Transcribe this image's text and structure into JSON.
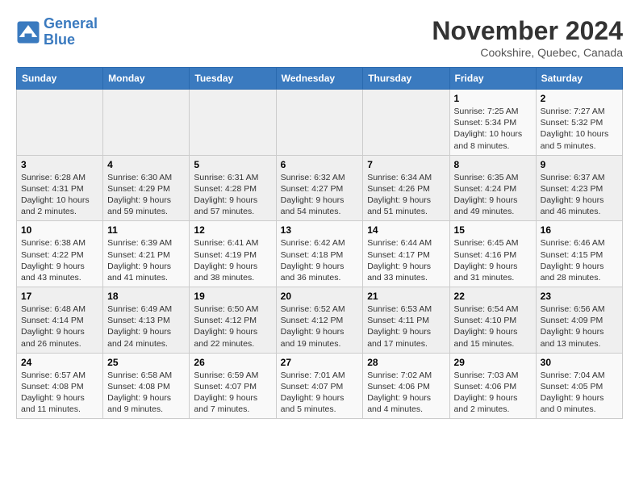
{
  "logo": {
    "line1": "General",
    "line2": "Blue"
  },
  "title": "November 2024",
  "location": "Cookshire, Quebec, Canada",
  "weekdays": [
    "Sunday",
    "Monday",
    "Tuesday",
    "Wednesday",
    "Thursday",
    "Friday",
    "Saturday"
  ],
  "rows": [
    [
      {
        "day": "",
        "info": ""
      },
      {
        "day": "",
        "info": ""
      },
      {
        "day": "",
        "info": ""
      },
      {
        "day": "",
        "info": ""
      },
      {
        "day": "",
        "info": ""
      },
      {
        "day": "1",
        "info": "Sunrise: 7:25 AM\nSunset: 5:34 PM\nDaylight: 10 hours and 8 minutes."
      },
      {
        "day": "2",
        "info": "Sunrise: 7:27 AM\nSunset: 5:32 PM\nDaylight: 10 hours and 5 minutes."
      }
    ],
    [
      {
        "day": "3",
        "info": "Sunrise: 6:28 AM\nSunset: 4:31 PM\nDaylight: 10 hours and 2 minutes."
      },
      {
        "day": "4",
        "info": "Sunrise: 6:30 AM\nSunset: 4:29 PM\nDaylight: 9 hours and 59 minutes."
      },
      {
        "day": "5",
        "info": "Sunrise: 6:31 AM\nSunset: 4:28 PM\nDaylight: 9 hours and 57 minutes."
      },
      {
        "day": "6",
        "info": "Sunrise: 6:32 AM\nSunset: 4:27 PM\nDaylight: 9 hours and 54 minutes."
      },
      {
        "day": "7",
        "info": "Sunrise: 6:34 AM\nSunset: 4:26 PM\nDaylight: 9 hours and 51 minutes."
      },
      {
        "day": "8",
        "info": "Sunrise: 6:35 AM\nSunset: 4:24 PM\nDaylight: 9 hours and 49 minutes."
      },
      {
        "day": "9",
        "info": "Sunrise: 6:37 AM\nSunset: 4:23 PM\nDaylight: 9 hours and 46 minutes."
      }
    ],
    [
      {
        "day": "10",
        "info": "Sunrise: 6:38 AM\nSunset: 4:22 PM\nDaylight: 9 hours and 43 minutes."
      },
      {
        "day": "11",
        "info": "Sunrise: 6:39 AM\nSunset: 4:21 PM\nDaylight: 9 hours and 41 minutes."
      },
      {
        "day": "12",
        "info": "Sunrise: 6:41 AM\nSunset: 4:19 PM\nDaylight: 9 hours and 38 minutes."
      },
      {
        "day": "13",
        "info": "Sunrise: 6:42 AM\nSunset: 4:18 PM\nDaylight: 9 hours and 36 minutes."
      },
      {
        "day": "14",
        "info": "Sunrise: 6:44 AM\nSunset: 4:17 PM\nDaylight: 9 hours and 33 minutes."
      },
      {
        "day": "15",
        "info": "Sunrise: 6:45 AM\nSunset: 4:16 PM\nDaylight: 9 hours and 31 minutes."
      },
      {
        "day": "16",
        "info": "Sunrise: 6:46 AM\nSunset: 4:15 PM\nDaylight: 9 hours and 28 minutes."
      }
    ],
    [
      {
        "day": "17",
        "info": "Sunrise: 6:48 AM\nSunset: 4:14 PM\nDaylight: 9 hours and 26 minutes."
      },
      {
        "day": "18",
        "info": "Sunrise: 6:49 AM\nSunset: 4:13 PM\nDaylight: 9 hours and 24 minutes."
      },
      {
        "day": "19",
        "info": "Sunrise: 6:50 AM\nSunset: 4:12 PM\nDaylight: 9 hours and 22 minutes."
      },
      {
        "day": "20",
        "info": "Sunrise: 6:52 AM\nSunset: 4:12 PM\nDaylight: 9 hours and 19 minutes."
      },
      {
        "day": "21",
        "info": "Sunrise: 6:53 AM\nSunset: 4:11 PM\nDaylight: 9 hours and 17 minutes."
      },
      {
        "day": "22",
        "info": "Sunrise: 6:54 AM\nSunset: 4:10 PM\nDaylight: 9 hours and 15 minutes."
      },
      {
        "day": "23",
        "info": "Sunrise: 6:56 AM\nSunset: 4:09 PM\nDaylight: 9 hours and 13 minutes."
      }
    ],
    [
      {
        "day": "24",
        "info": "Sunrise: 6:57 AM\nSunset: 4:08 PM\nDaylight: 9 hours and 11 minutes."
      },
      {
        "day": "25",
        "info": "Sunrise: 6:58 AM\nSunset: 4:08 PM\nDaylight: 9 hours and 9 minutes."
      },
      {
        "day": "26",
        "info": "Sunrise: 6:59 AM\nSunset: 4:07 PM\nDaylight: 9 hours and 7 minutes."
      },
      {
        "day": "27",
        "info": "Sunrise: 7:01 AM\nSunset: 4:07 PM\nDaylight: 9 hours and 5 minutes."
      },
      {
        "day": "28",
        "info": "Sunrise: 7:02 AM\nSunset: 4:06 PM\nDaylight: 9 hours and 4 minutes."
      },
      {
        "day": "29",
        "info": "Sunrise: 7:03 AM\nSunset: 4:06 PM\nDaylight: 9 hours and 2 minutes."
      },
      {
        "day": "30",
        "info": "Sunrise: 7:04 AM\nSunset: 4:05 PM\nDaylight: 9 hours and 0 minutes."
      }
    ]
  ]
}
